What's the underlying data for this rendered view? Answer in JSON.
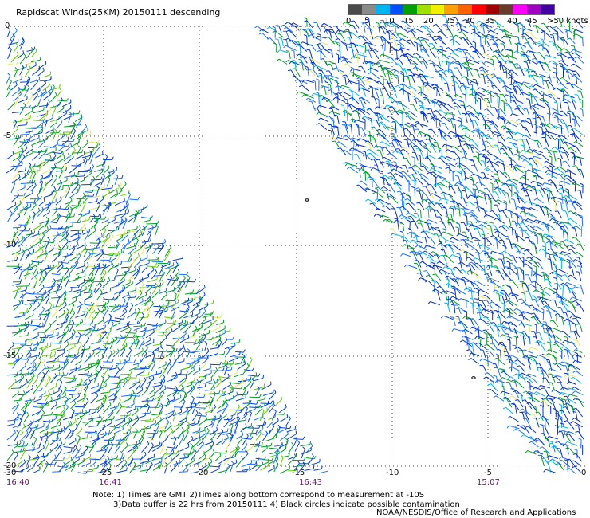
{
  "title": "Rapidscat Winds(25KM) 20150111 descending",
  "legend": {
    "labels": [
      "0",
      "5",
      "10",
      "15",
      "20",
      "25",
      "30",
      "35",
      "40",
      "45",
      ">50 knots"
    ],
    "colors": [
      "#4a4a4a",
      "#8a8a8a",
      "#00b4f0",
      "#0050ff",
      "#00a000",
      "#a0e000",
      "#f0f000",
      "#ffa000",
      "#ff6000",
      "#ff0000",
      "#a00000",
      "#6a3a2a",
      "#ff00ff",
      "#a000c0",
      "#4000a0"
    ]
  },
  "axes": {
    "y_labels": [
      "0",
      "-5",
      "-10",
      "-15",
      "-20"
    ],
    "x_labels": [
      "-30",
      "-25",
      "-20",
      "-15",
      "-10",
      "-5",
      "0"
    ]
  },
  "pass_times": [
    "16:40",
    "16:41",
    "16:43",
    "15:07"
  ],
  "notes": {
    "line1": "Note: 1) Times are GMT 2)Times along bottom correspond to measurement at -10S",
    "line2": "3)Data buffer is 22 hrs from 20150111 4) Black circles indicate possible contamination",
    "credit": "NOAA/NESDIS/Office of Research and Applications"
  }
}
